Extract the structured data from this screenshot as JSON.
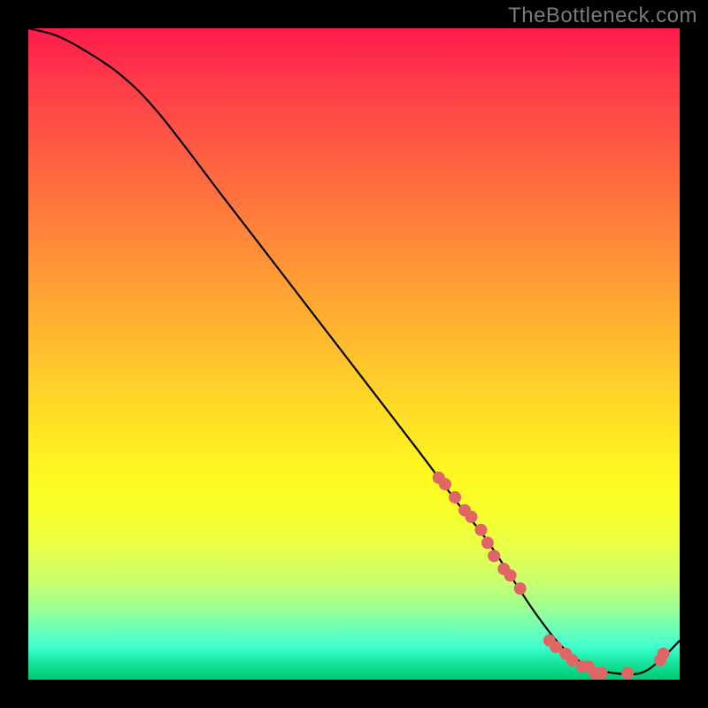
{
  "watermark": "TheBottleneck.com",
  "chart_data": {
    "type": "line",
    "title": "",
    "xlabel": "",
    "ylabel": "",
    "xlim": [
      0,
      100
    ],
    "ylim": [
      0,
      100
    ],
    "grid": false,
    "legend": false,
    "series": [
      {
        "name": "bottleneck-curve",
        "color": "#000000",
        "x": [
          0,
          4,
          8,
          14,
          20,
          30,
          40,
          50,
          60,
          66,
          70,
          74,
          78,
          82,
          86,
          90,
          94,
          97,
          100
        ],
        "y": [
          100,
          99,
          97,
          93,
          87,
          74,
          61,
          48,
          35,
          27,
          22,
          16,
          10,
          5,
          2,
          1,
          1,
          3,
          6
        ]
      }
    ],
    "scatter_points": {
      "name": "marked-points",
      "color": "#e06666",
      "x": [
        63,
        64,
        65.5,
        67,
        68,
        69.5,
        70.5,
        71.5,
        73,
        74,
        75.5,
        80,
        81,
        82.5,
        83.5,
        85,
        86,
        87,
        88,
        92,
        97,
        97.5
      ],
      "y": [
        31,
        30,
        28,
        26,
        25,
        23,
        21,
        19,
        17,
        16,
        14,
        6,
        5,
        4,
        3,
        2,
        2,
        1,
        1,
        1,
        3,
        4
      ]
    },
    "background_gradient": {
      "top_color": "#ff1a4b",
      "mid_color": "#fff820",
      "bottom_color": "#00c96f"
    }
  }
}
